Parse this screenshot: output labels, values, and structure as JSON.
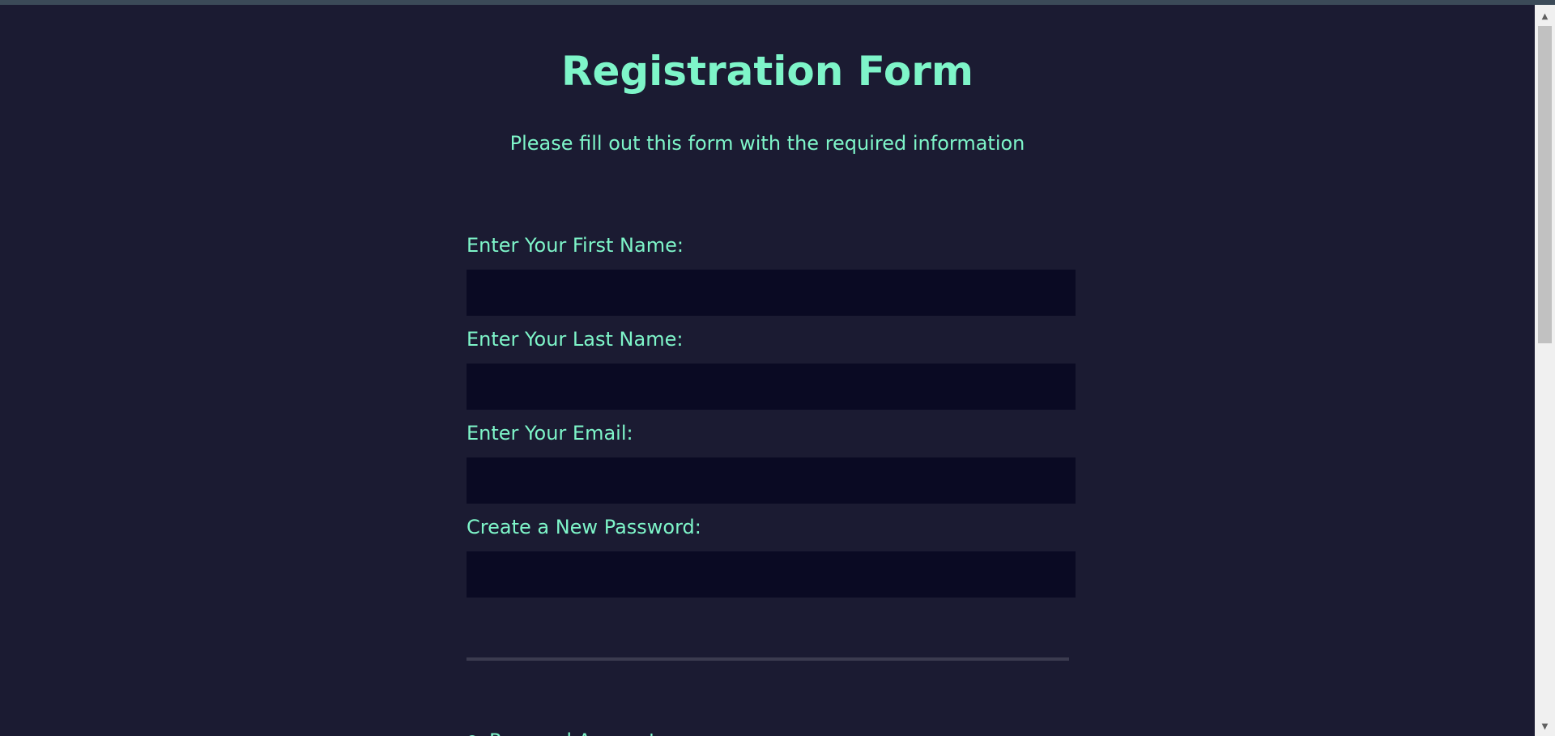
{
  "form": {
    "title": "Registration Form",
    "subtitle": "Please fill out this form with the required information",
    "fields": [
      {
        "label": "Enter Your First Name:",
        "value": "",
        "placeholder": ""
      },
      {
        "label": "Enter Your Last Name:",
        "value": "",
        "placeholder": ""
      },
      {
        "label": "Enter Your Email:",
        "value": "",
        "placeholder": ""
      },
      {
        "label": "Create a New Password:",
        "value": "",
        "placeholder": ""
      }
    ],
    "next_section_label": "Personal Account"
  },
  "scrollbar": {
    "up_icon": "arrow-up-icon",
    "down_icon": "arrow-down-icon"
  },
  "colors": {
    "background": "#1b1b32",
    "accent_text": "#7ef5c9",
    "input_background": "#0a0a23",
    "divider": "#3b3b4f"
  }
}
